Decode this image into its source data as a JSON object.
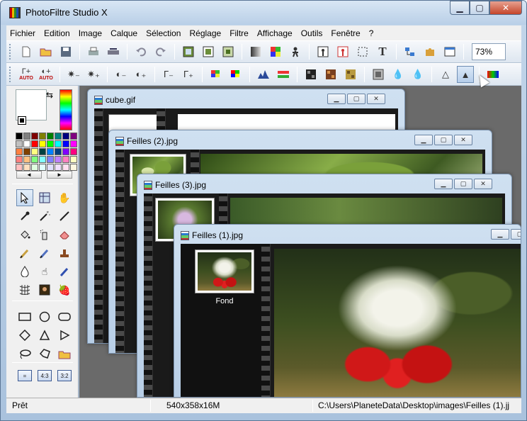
{
  "window": {
    "title": "PhotoFiltre Studio X"
  },
  "caption_buttons": {
    "minimize": "▁",
    "maximize": "▢",
    "close": "✕"
  },
  "menu": [
    "Fichier",
    "Edition",
    "Image",
    "Calque",
    "Sélection",
    "Réglage",
    "Filtre",
    "Affichage",
    "Outils",
    "Fenêtre",
    "?"
  ],
  "toolbar1": {
    "icons": [
      "new-file-icon",
      "open-folder-icon",
      "save-disk-icon",
      "print-icon",
      "scan-icon",
      "undo-icon",
      "redo-icon",
      "image-size-icon",
      "canvas-size-icon",
      "crop-icon",
      "gradient-icon",
      "color-grid-icon",
      "person-icon",
      "transform-icon",
      "cutout-icon",
      "selection-icon",
      "text-icon",
      "layers-icon",
      "puzzle-icon",
      "window-icon"
    ],
    "zoom": "73%"
  },
  "toolbar2": {
    "auto_label": "AUTO",
    "icons": [
      "auto-levels-icon",
      "auto-contrast-icon",
      "brightness-minus-icon",
      "brightness-plus-icon",
      "contrast-minus-icon",
      "contrast-plus-icon",
      "gamma-minus-icon",
      "gamma-plus-icon",
      "saturation-minus-icon",
      "saturation-plus-icon",
      "histogram-icon",
      "color-balance-icon",
      "pixelate-icon",
      "mosaic-icon",
      "texture-icon",
      "emboss-icon",
      "drop-icon",
      "blur-icon",
      "sharpen-icon",
      "sharpen-more-icon",
      "gradient-map-icon"
    ]
  },
  "palette": {
    "colors": [
      "#000000",
      "#808080",
      "#800000",
      "#808000",
      "#008000",
      "#008080",
      "#000080",
      "#800080",
      "#c0c0c0",
      "#ffffff",
      "#ff0000",
      "#ffff00",
      "#00ff00",
      "#00ffff",
      "#0000ff",
      "#ff00ff",
      "#ff8040",
      "#804000",
      "#ffff80",
      "#004040",
      "#0080ff",
      "#004080",
      "#8000ff",
      "#ff0080",
      "#ff8080",
      "#ffc080",
      "#80ff80",
      "#80ffff",
      "#8080ff",
      "#c080ff",
      "#ff80c0",
      "#ffffc0",
      "#ffc0c0",
      "#ffe0c0",
      "#e0ffe0",
      "#e0ffff",
      "#e0e0ff",
      "#f0e0ff",
      "#ffe0f0",
      "#fff8e0"
    ],
    "nav_prev": "◄",
    "nav_next": "►"
  },
  "tools": [
    "select-arrow-icon",
    "grid-select-icon",
    "hand-icon",
    "eyedropper-icon",
    "magic-wand-icon",
    "line-icon",
    "fill-bucket-icon",
    "spray-icon",
    "eraser-icon",
    "brush-icon",
    "smudge-brush-icon",
    "stamp-icon",
    "drop-blur-icon",
    "finger-icon",
    "effect-brush-icon",
    "deform-grid-icon",
    "portrait-icon",
    "strawberry-icon"
  ],
  "shapes": [
    "rectangle-icon",
    "ellipse-icon",
    "rounded-rect-icon",
    "diamond-icon",
    "triangle-icon",
    "arrow-right-icon",
    "lasso-icon",
    "polygon-lasso-icon",
    "open-shape-icon"
  ],
  "ratios": [
    "=",
    "4:3",
    "3:2"
  ],
  "documents": [
    {
      "name": "cube.gif"
    },
    {
      "name": "Feilles (2).jpg"
    },
    {
      "name": "Feilles (3).jpg"
    },
    {
      "name": "Feilles (1).jpg",
      "layer": "Fond"
    }
  ],
  "status": {
    "state": "Prêt",
    "size": "540x358x16M",
    "path": "C:\\Users\\PlaneteData\\Desktop\\images\\Feilles (1).jj"
  },
  "colors": {
    "accent": "#b9cfe7",
    "workspace": "#6a6a6a"
  }
}
